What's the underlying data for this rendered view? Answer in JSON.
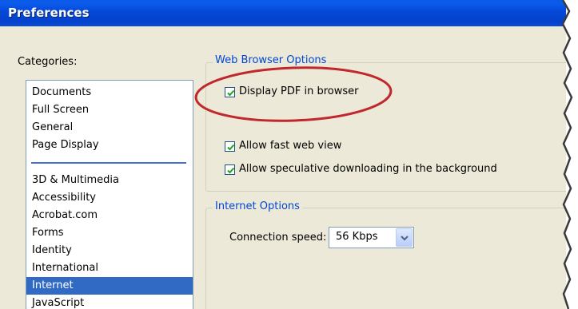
{
  "window": {
    "title": "Preferences"
  },
  "categories": {
    "label": "Categories:",
    "label_hotkey": "g",
    "group1": [
      "Documents",
      "Full Screen",
      "General",
      "Page Display"
    ],
    "group2": [
      "3D & Multimedia",
      "Accessibility",
      "Acrobat.com",
      "Forms",
      "Identity",
      "International",
      "Internet",
      "JavaScript"
    ],
    "selected": "Internet"
  },
  "web_browser_options": {
    "legend": "Web Browser Options",
    "display_pdf": {
      "label": "Display PDF in browser",
      "hotkey": "D",
      "checked": true
    },
    "fast_web_view": {
      "label": "Allow fast web view",
      "hotkey": "A",
      "checked": true
    },
    "speculative": {
      "label": "Allow speculative downloading in the background",
      "hotkey": "s",
      "checked": true
    }
  },
  "internet_options": {
    "legend": "Internet Options",
    "connection_speed": {
      "label": "Connection speed:",
      "hotkey": "o",
      "value": "56 Kbps"
    }
  },
  "colors": {
    "titlebar": "#0548d8",
    "selection": "#316ac5",
    "legend_text": "#0046d5",
    "annotation": "#c0282d"
  },
  "icons": {
    "checkbox": "checkmark-icon",
    "dropdown": "chevron-down-icon"
  }
}
